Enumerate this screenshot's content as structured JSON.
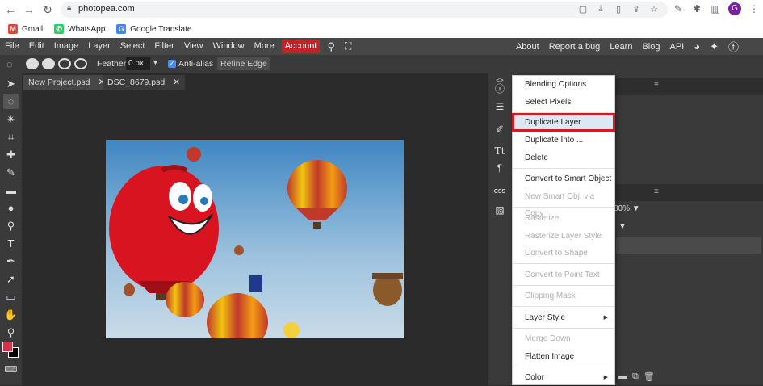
{
  "browser": {
    "url": "photopea.com",
    "bookmarks": [
      {
        "label": "Gmail",
        "icon": "gmail-icon",
        "icon_glyph": "M",
        "color": "#ea4335"
      },
      {
        "label": "WhatsApp",
        "icon": "whatsapp-icon",
        "icon_glyph": "✆",
        "color": "#25d366"
      },
      {
        "label": "Google Translate",
        "icon": "translate-icon",
        "icon_glyph": "G",
        "color": "#4285f4"
      }
    ],
    "profile_initial": "G"
  },
  "menubar": {
    "items": [
      "File",
      "Edit",
      "Image",
      "Layer",
      "Select",
      "Filter",
      "View",
      "Window",
      "More"
    ],
    "account_label": "Account",
    "right_links": [
      "About",
      "Report a bug",
      "Learn",
      "Blog",
      "API"
    ]
  },
  "options": {
    "feather_label": "Feather:",
    "feather_value": "0 px",
    "antialias_label": "Anti-alias",
    "refine_label": "Refine Edge"
  },
  "tabs": [
    {
      "label": "New Project.psd",
      "close": "✕"
    },
    {
      "label": "DSC_8679.psd",
      "close": "✕"
    }
  ],
  "layers_panel": {
    "opacity_value": "80%"
  },
  "context_menu": {
    "items": [
      {
        "label": "Blending Options",
        "enabled": true
      },
      {
        "label": "Select Pixels",
        "enabled": true
      },
      {
        "label": "Duplicate Layer",
        "enabled": true,
        "highlighted": true
      },
      {
        "label": "Duplicate Into ...",
        "enabled": true
      },
      {
        "label": "Delete",
        "enabled": true
      },
      {
        "label": "Convert to Smart Object",
        "enabled": true
      },
      {
        "label": "New Smart Obj. via Copy",
        "enabled": false
      },
      {
        "label": "Rasterize",
        "enabled": false
      },
      {
        "label": "Rasterize Layer Style",
        "enabled": false
      },
      {
        "label": "Convert to Shape",
        "enabled": false
      },
      {
        "label": "Convert to Point Text",
        "enabled": false
      },
      {
        "label": "Clipping Mask",
        "enabled": false
      },
      {
        "label": "Layer Style",
        "enabled": true,
        "submenu": true
      },
      {
        "label": "Merge Down",
        "enabled": false
      },
      {
        "label": "Flatten Image",
        "enabled": true
      },
      {
        "label": "Color",
        "enabled": true,
        "submenu": true
      }
    ]
  },
  "colors": {
    "foreground": "#d1334a",
    "background": "#000000",
    "highlight_outline": "#d11c24",
    "account_bg": "#c8202b"
  }
}
